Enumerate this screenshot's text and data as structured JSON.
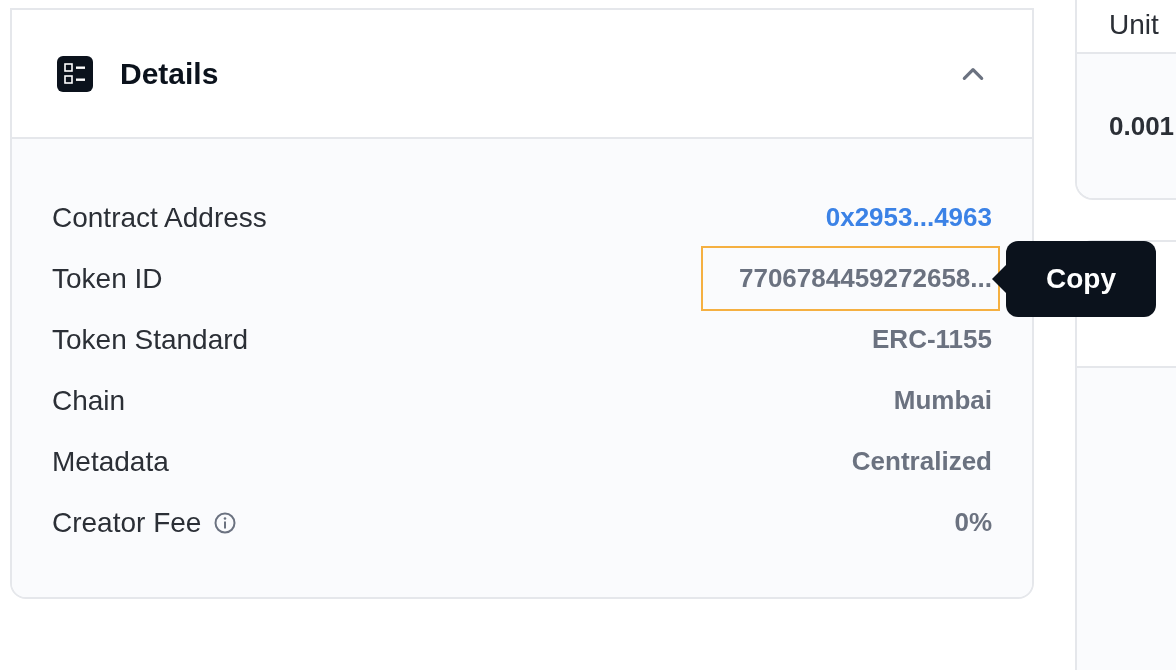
{
  "details": {
    "title": "Details",
    "expanded": true,
    "rows": [
      {
        "label": "Contract Address",
        "value": "0x2953...4963",
        "kind": "link",
        "highlighted": false,
        "info": false
      },
      {
        "label": "Token ID",
        "value": "7706784459272658...",
        "kind": "text",
        "highlighted": true,
        "info": false
      },
      {
        "label": "Token Standard",
        "value": "ERC-1155",
        "kind": "text",
        "highlighted": false,
        "info": false
      },
      {
        "label": "Chain",
        "value": "Mumbai",
        "kind": "text",
        "highlighted": false,
        "info": false
      },
      {
        "label": "Metadata",
        "value": "Centralized",
        "kind": "text",
        "highlighted": false,
        "info": false
      },
      {
        "label": "Creator Fee",
        "value": "0%",
        "kind": "text",
        "highlighted": false,
        "info": true
      }
    ]
  },
  "tooltip": {
    "label": "Copy"
  },
  "price_card": {
    "header": "Unit",
    "value": "0.001"
  }
}
